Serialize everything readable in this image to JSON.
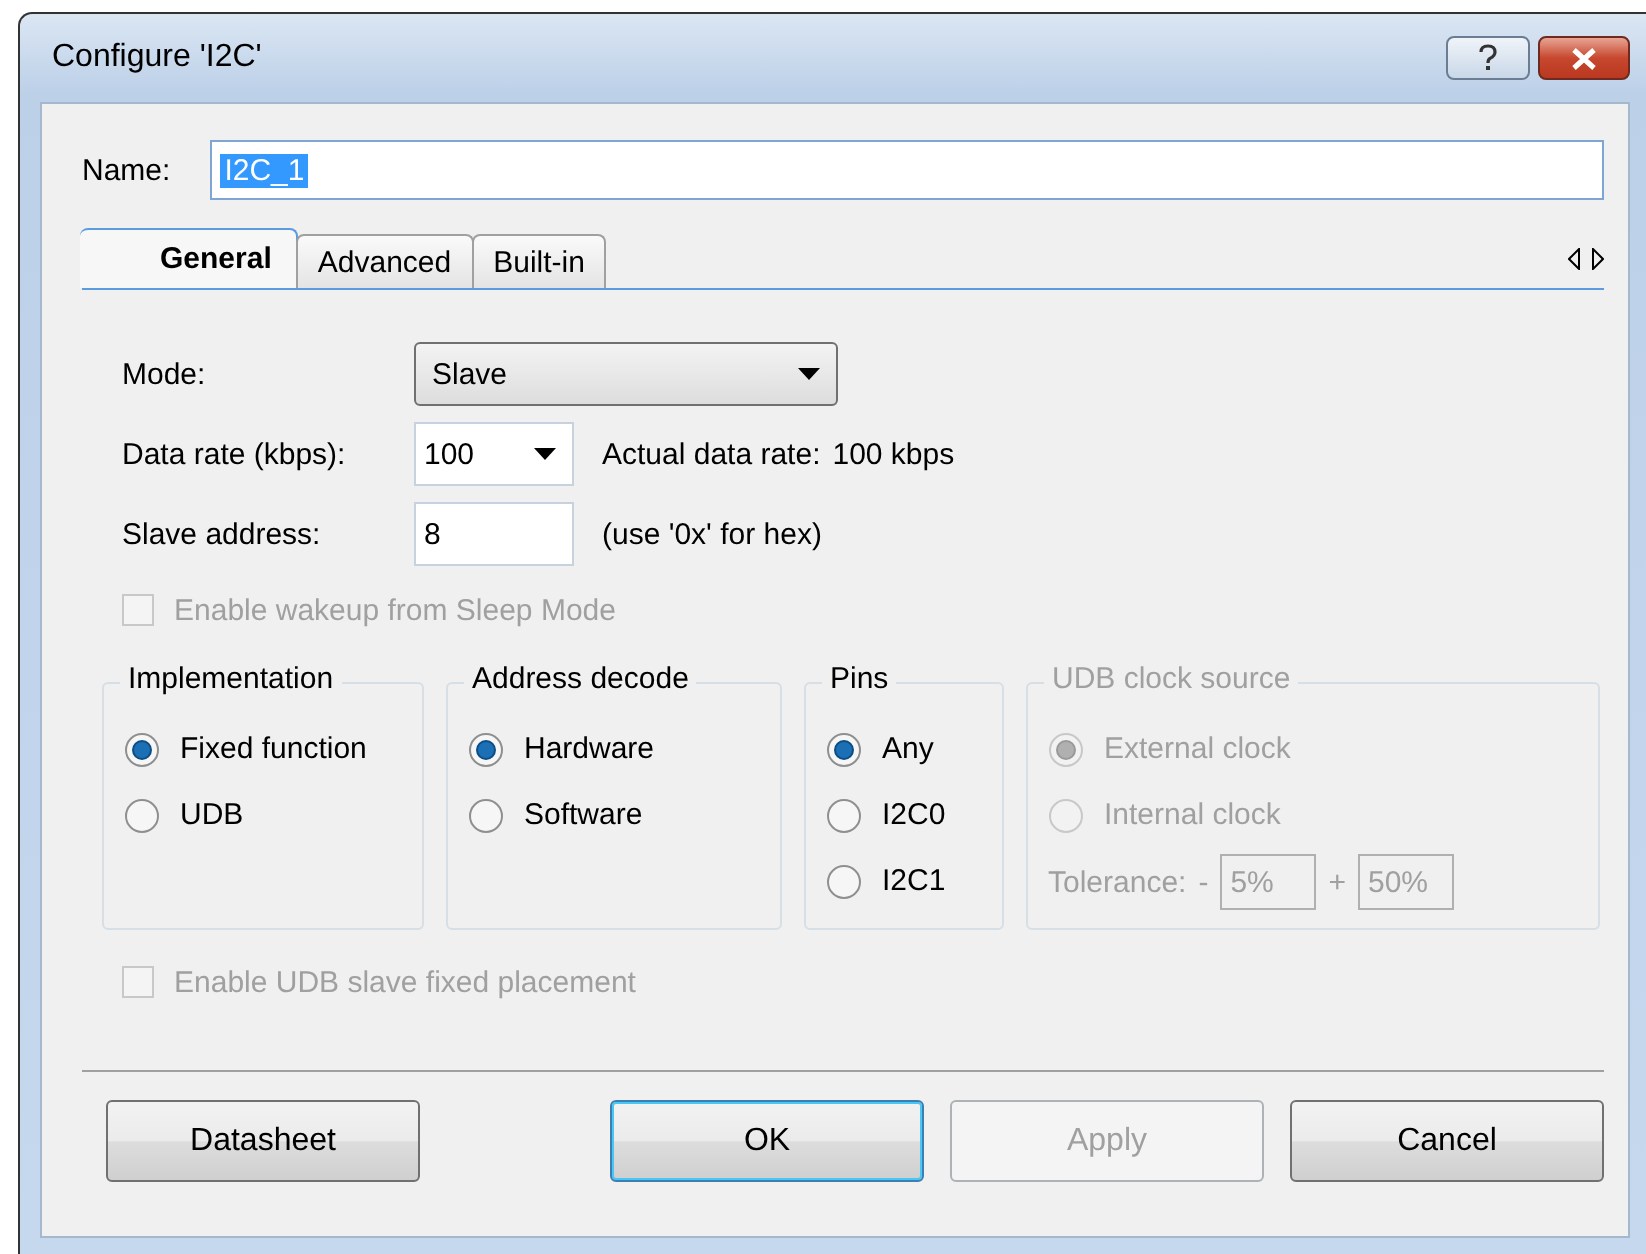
{
  "window": {
    "title": "Configure 'I2C'"
  },
  "name": {
    "label": "Name:",
    "value": "I2C_1",
    "selected": true
  },
  "tabs": [
    {
      "label": "General",
      "selected": true
    },
    {
      "label": "Advanced",
      "selected": false
    },
    {
      "label": "Built-in",
      "selected": false
    }
  ],
  "fields": [
    {
      "kind": "dropdown",
      "label": "Mode:",
      "value": "Slave"
    },
    {
      "kind": "combo",
      "label": "Data rate (kbps):",
      "value": "100",
      "note": "Actual data rate:",
      "reading": "100 kbps"
    },
    {
      "kind": "text",
      "label": "Slave address:",
      "value": "8",
      "note": "(use '0x' for hex)"
    }
  ],
  "wakeup": {
    "label": "Enable wakeup from Sleep Mode",
    "checked": false,
    "disabled": true
  },
  "groups": [
    {
      "title": "Implementation",
      "disabled": false,
      "options": [
        {
          "label": "Fixed function",
          "selected": true
        },
        {
          "label": "UDB",
          "selected": false
        }
      ]
    },
    {
      "title": "Address decode",
      "disabled": false,
      "options": [
        {
          "label": "Hardware",
          "selected": true
        },
        {
          "label": "Software",
          "selected": false
        }
      ]
    },
    {
      "title": "Pins",
      "disabled": false,
      "options": [
        {
          "label": "Any",
          "selected": true
        },
        {
          "label": "I2C0",
          "selected": false
        },
        {
          "label": "I2C1",
          "selected": false
        }
      ]
    },
    {
      "title": "UDB clock source",
      "disabled": true,
      "options": [
        {
          "label": "External clock",
          "selected": true
        },
        {
          "label": "Internal clock",
          "selected": false
        }
      ],
      "tolerance": {
        "label": "Tolerance:",
        "minus": "-",
        "min": "5%",
        "plus": "+",
        "max": "50%"
      }
    }
  ],
  "placement": {
    "label": "Enable UDB slave fixed placement",
    "checked": false,
    "disabled": true
  },
  "buttons": [
    {
      "label": "Datasheet",
      "disabled": false,
      "default": false
    },
    {
      "label": "OK",
      "disabled": false,
      "default": true
    },
    {
      "label": "Apply",
      "disabled": true,
      "default": false
    },
    {
      "label": "Cancel",
      "disabled": false,
      "default": false
    }
  ]
}
